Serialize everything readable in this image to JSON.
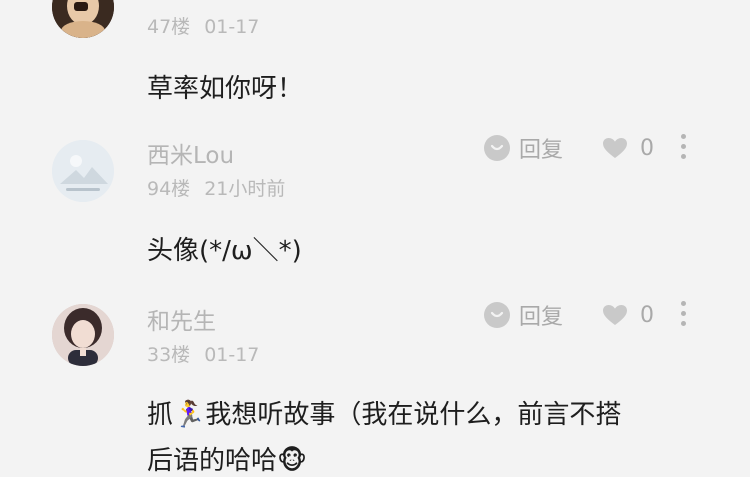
{
  "comments": [
    {
      "floor": "47楼",
      "date": "01-17",
      "text": "草率如你呀！"
    },
    {
      "username": "西米Lou",
      "floor": "94楼",
      "date": "21小时前",
      "reply_label": "回复",
      "likes": "0",
      "text": "头像(*/ω＼*)"
    },
    {
      "username": "和先生",
      "floor": "33楼",
      "date": "01-17",
      "reply_label": "回复",
      "likes": "0",
      "text_line1": "抓🏃‍♀️我想听故事（我在说什么，前言不搭",
      "text_line2": "后语的哈哈🐵"
    }
  ],
  "colors": {
    "background": "#f3f3f3",
    "text_primary": "#1e1e1e",
    "text_secondary": "#b5b5b5",
    "icon_gray": "#c9c9c9"
  }
}
